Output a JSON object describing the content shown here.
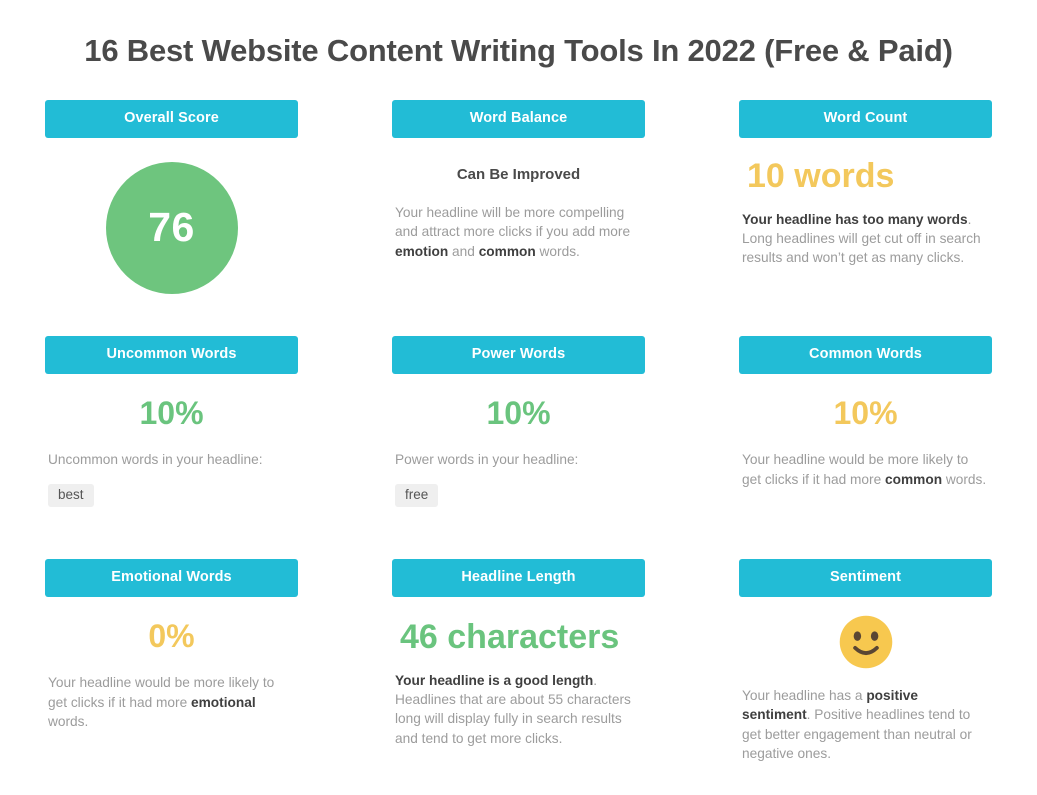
{
  "page": {
    "title": "16 Best Website Content Writing Tools In 2022 (Free & Paid)"
  },
  "colors": {
    "header_teal": "#22bcd6",
    "score_green": "#6ec57e",
    "metric_green": "#6ac47e",
    "metric_yellow": "#f3c85c",
    "body_text": "#9c9c9c",
    "bold_text": "#3f3f3f",
    "chip_bg": "#efefef"
  },
  "cards": {
    "overall_score": {
      "header": "Overall Score",
      "score": "76"
    },
    "word_balance": {
      "header": "Word Balance",
      "verdict": "Can Be Improved",
      "desc_1": "Your headline will be more compelling and attract more clicks if you add more ",
      "desc_bold_1": "emotion",
      "desc_2": " and ",
      "desc_bold_2": "common",
      "desc_3": " words."
    },
    "word_count": {
      "header": "Word Count",
      "value": "10 words",
      "value_color": "yellow",
      "desc_bold_1": "Your headline has too many words",
      "desc_1": ". Long headlines will get cut off in search results and won’t get as many clicks."
    },
    "uncommon_words": {
      "header": "Uncommon Words",
      "value": "10%",
      "value_color": "green",
      "desc_1": "Uncommon words in your headline:",
      "chips": [
        "best"
      ]
    },
    "power_words": {
      "header": "Power Words",
      "value": "10%",
      "value_color": "green",
      "desc_1": "Power words in your headline:",
      "chips": [
        "free"
      ]
    },
    "common_words": {
      "header": "Common Words",
      "value": "10%",
      "value_color": "yellow",
      "desc_1": "Your headline would be more likely to get clicks if it had more ",
      "desc_bold_1": "common",
      "desc_2": " words."
    },
    "emotional_words": {
      "header": "Emotional Words",
      "value": "0%",
      "value_color": "yellow",
      "desc_1": "Your headline would be more likely to get clicks if it had more ",
      "desc_bold_1": "emotional",
      "desc_2": " words."
    },
    "headline_length": {
      "header": "Headline Length",
      "value": "46 characters",
      "value_color": "green",
      "desc_bold_1": "Your headline is a good length",
      "desc_1": ". Headlines that are about 55 characters long will display fully in search results and tend to get more clicks."
    },
    "sentiment": {
      "header": "Sentiment",
      "emoji_name": "slightly-smiling-face",
      "desc_1": "Your headline has a ",
      "desc_bold_1": "positive sentiment",
      "desc_2": ". Positive headlines tend to get better engagement than neutral or negative ones."
    }
  }
}
